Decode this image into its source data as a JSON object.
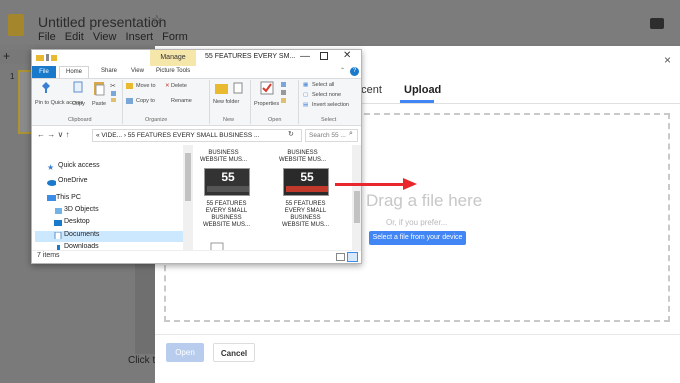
{
  "slides": {
    "title": "Untitled presentation",
    "star": "☆",
    "menu": [
      "File",
      "Edit",
      "View",
      "Insert",
      "Form"
    ],
    "plus": "+",
    "thumbnail_number": "1",
    "click_text": "Click to"
  },
  "dialog": {
    "close": "×",
    "tabs": {
      "recent": "ecent",
      "upload": "Upload"
    },
    "drag_text": "Drag a file here",
    "or_text": "Or, if you prefer...",
    "select_button": "Select a file from your device",
    "open_button": "Open",
    "cancel_button": "Cancel",
    "accent": "#4285f4"
  },
  "explorer": {
    "manage_tab": "Manage",
    "title": "55 FEATURES EVERY SM...",
    "controls": {
      "minimize": "—",
      "close": "✕"
    },
    "ribbon_tabs": {
      "file": "File",
      "home": "Home",
      "share": "Share",
      "view": "View",
      "picture_tools": "Picture Tools"
    },
    "ribbon": {
      "pin": "Pin to Quick access",
      "copy": "Copy",
      "paste": "Paste",
      "move_to": "Move to",
      "delete": "Delete",
      "copy_to": "Copy to",
      "rename": "Rename",
      "new_folder": "New folder",
      "properties": "Properties",
      "select_all": "Select all",
      "select_none": "Select none",
      "invert_selection": "Invert selection",
      "groups": {
        "clipboard": "Clipboard",
        "organize": "Organize",
        "new": "New",
        "open": "Open",
        "select": "Select"
      }
    },
    "nav_arrows": "←  →  ∨  ↑",
    "address": "« VIDE... › 55 FEATURES EVERY SMALL BUSINESS ...",
    "search_placeholder": "Search 55 ...",
    "nav_items": [
      {
        "label": "Quick access"
      },
      {
        "label": "OneDrive"
      },
      {
        "label": "This PC"
      },
      {
        "label": "3D Objects"
      },
      {
        "label": "Desktop"
      },
      {
        "label": "Documents"
      },
      {
        "label": "Downloads"
      }
    ],
    "files": [
      {
        "label": "BUSINESS WEBSITE MUS..."
      },
      {
        "label": "BUSINESS WEBSITE MUS..."
      },
      {
        "label": "55 FEATURES EVERY SMALL BUSINESS WEBSITE MUS...",
        "thumb_text": "55"
      },
      {
        "label": "55 FEATURES EVERY SMALL BUSINESS WEBSITE MUS...",
        "thumb_text": "55"
      }
    ],
    "status": "7 items",
    "accent": "#1979ca"
  },
  "arrow_color": "#e8262b"
}
